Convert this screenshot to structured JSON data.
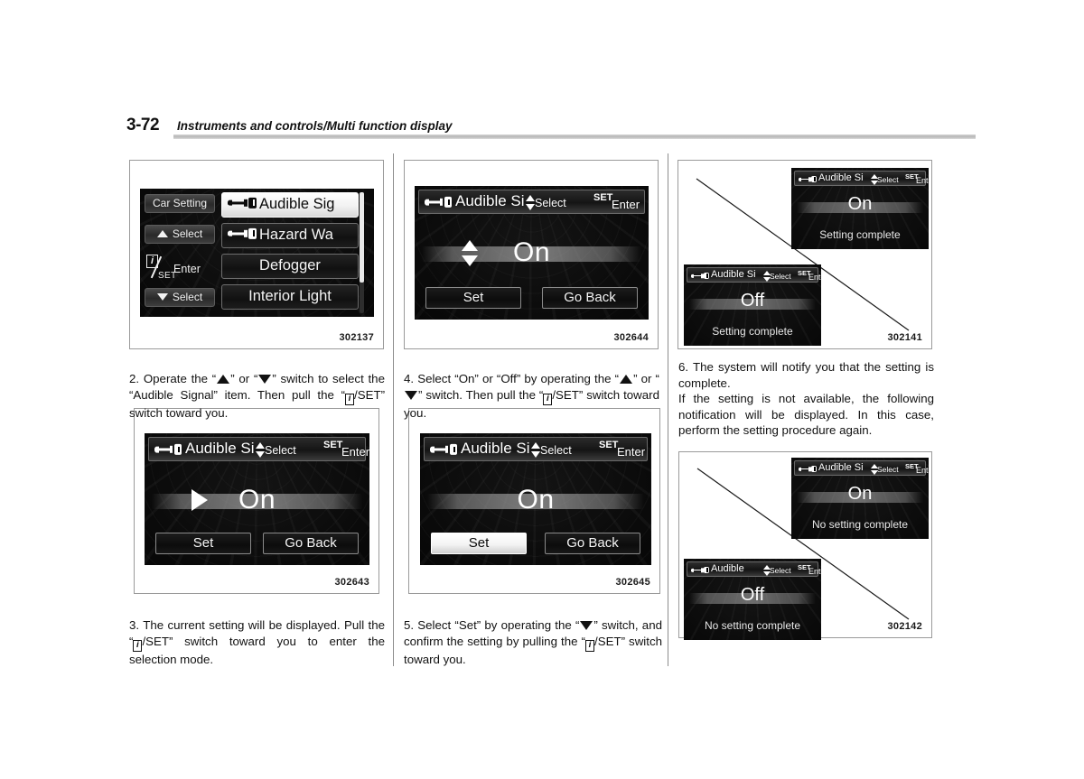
{
  "header": {
    "page_number": "3-72",
    "title": "Instruments and controls/Multi function display"
  },
  "figures": {
    "fig1": {
      "code": "302137",
      "rail": {
        "car_setting": "Car Setting",
        "select_up": "Select",
        "select_down": "Select",
        "enter": "Enter",
        "set": "SET",
        "info_icon": "i"
      },
      "menu_items": [
        {
          "label": "Audible Sig",
          "has_key_icon": true,
          "selected": true
        },
        {
          "label": "Hazard Wa",
          "has_key_icon": true,
          "selected": false
        },
        {
          "label": "Defogger",
          "has_key_icon": false,
          "selected": false
        },
        {
          "label": "Interior Light",
          "has_key_icon": false,
          "selected": false
        }
      ]
    },
    "fig2": {
      "code": "302644",
      "header": {
        "title": "Audible Si",
        "select": "Select",
        "set": "SET",
        "enter": "Enter"
      },
      "value": "On",
      "buttons": {
        "set": "Set",
        "go_back": "Go Back"
      },
      "indicator": "up-down-arrows"
    },
    "fig3": {
      "code": "302141",
      "screens": [
        {
          "header": {
            "title": "Audible Si",
            "select": "Select",
            "set": "SET",
            "enter": "Enter"
          },
          "value": "On",
          "note": "Setting complete"
        },
        {
          "header": {
            "title": "Audible Si",
            "select": "Select",
            "set": "SET",
            "enter": "Enter"
          },
          "value": "Off",
          "note": "Setting complete"
        }
      ]
    },
    "fig4": {
      "code": "302643",
      "header": {
        "title": "Audible Si",
        "select": "Select",
        "set": "SET",
        "enter": "Enter"
      },
      "value": "On",
      "buttons": {
        "set": "Set",
        "go_back": "Go Back"
      },
      "indicator": "right-arrow"
    },
    "fig5": {
      "code": "302645",
      "header": {
        "title": "Audible Si",
        "select": "Select",
        "set": "SET",
        "enter": "Enter"
      },
      "value": "On",
      "buttons": {
        "set": "Set",
        "go_back": "Go Back"
      },
      "highlighted_button": "Set"
    },
    "fig6": {
      "code": "302142",
      "screens": [
        {
          "header": {
            "title": "Audible Si",
            "select": "Select",
            "set": "SET",
            "enter": "Enter"
          },
          "value": "On",
          "note": "No setting complete"
        },
        {
          "header": {
            "title": "Audible",
            "select": "Select",
            "set": "SET",
            "enter": "Enter"
          },
          "value": "Off",
          "note": "No setting complete"
        }
      ]
    }
  },
  "steps": {
    "step2": {
      "a": "2.  Operate the “",
      "b": "” or “",
      "c": "” switch to select the “Audible Signal” item. Then pull the “",
      "d": "/SET” switch toward you."
    },
    "step3": {
      "a": "3.  The current setting will be displayed. Pull the “",
      "b": "/SET” switch toward you to enter the selection mode."
    },
    "step4": {
      "a": "4.  Select “On” or “Off” by operating the “",
      "b": "” or “",
      "c": "” switch. Then pull the “",
      "d": "/SET” switch toward you."
    },
    "step5": {
      "a": "5. Select “Set” by operating the “",
      "b": "” switch, and confirm the setting by pulling the “",
      "c": "/SET” switch toward you."
    },
    "step6": {
      "a": "6.  The system will notify you that the setting is complete.",
      "b": "If the setting is not available, the following notification will be displayed. In this case, perform the setting procedure again."
    }
  },
  "icons": {
    "info": "i",
    "key": "key-icon"
  }
}
